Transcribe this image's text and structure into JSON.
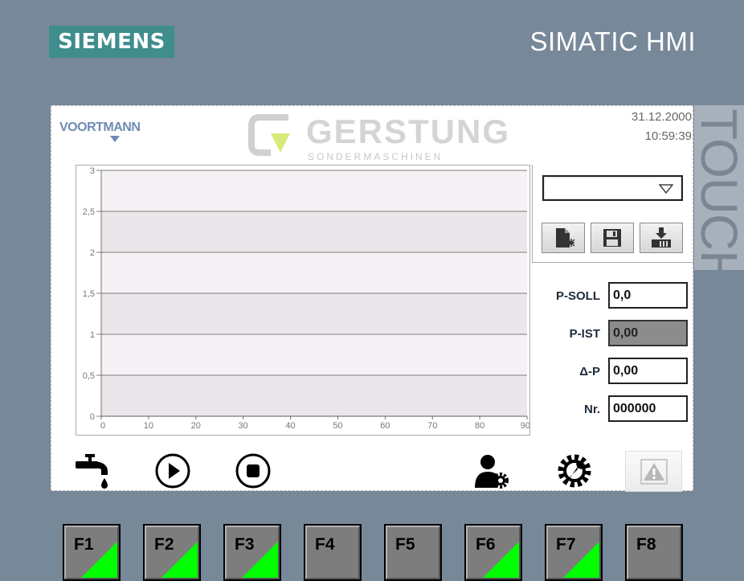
{
  "bezel": {
    "brand": "SIEMENS",
    "product": "SIMATIC HMI",
    "touch_label": "TOUCH",
    "brand_color": "#3f8d8d"
  },
  "header": {
    "logo_left": "VOORTMANN",
    "logo_center_name": "GERSTUNG",
    "logo_center_sub": "SONDERMASCHINEN",
    "date": "31.12.2000",
    "time": "10:59:39"
  },
  "chart_data": {
    "type": "line",
    "title": "",
    "xlabel": "",
    "ylabel": "",
    "xlim": [
      0,
      90
    ],
    "ylim": [
      0,
      3
    ],
    "x_ticks": [
      "0",
      "10",
      "20",
      "30",
      "40",
      "50",
      "60",
      "70",
      "80",
      "90"
    ],
    "y_ticks": [
      "0",
      "0,5",
      "1",
      "1,5",
      "2",
      "2,5",
      "3"
    ],
    "series": [],
    "grid": true
  },
  "recipe_select": {
    "value": ""
  },
  "tools": [
    {
      "name": "new-recipe",
      "icon": "new-document-icon"
    },
    {
      "name": "save-recipe",
      "icon": "floppy-disk-icon"
    },
    {
      "name": "load-recipe",
      "icon": "download-to-plc-icon"
    }
  ],
  "fields": {
    "p_soll": {
      "label": "P-SOLL",
      "value": "0,0"
    },
    "p_ist": {
      "label": "P-IST",
      "value": "0,00"
    },
    "delta_p": {
      "label": "Δ-P",
      "value": "0,00"
    },
    "nr": {
      "label": "Nr.",
      "value": "000000"
    }
  },
  "bottom_bar": [
    {
      "name": "water-tap",
      "icon": "water-tap-icon"
    },
    {
      "name": "start",
      "icon": "play-circle-icon"
    },
    {
      "name": "stop",
      "icon": "stop-circle-icon"
    },
    {
      "name": "user-settings",
      "icon": "user-gear-icon"
    },
    {
      "name": "service",
      "icon": "wrench-gear-icon"
    },
    {
      "name": "alarm",
      "icon": "warning-icon"
    }
  ],
  "function_keys": [
    {
      "label": "F1",
      "active": true
    },
    {
      "label": "F2",
      "active": true
    },
    {
      "label": "F3",
      "active": true
    },
    {
      "label": "F4",
      "active": false
    },
    {
      "label": "F5",
      "active": false
    },
    {
      "label": "F6",
      "active": true
    },
    {
      "label": "F7",
      "active": true
    },
    {
      "label": "F8",
      "active": false
    }
  ],
  "colors": {
    "fkey_indicator": "#00ff00",
    "bezel": "#778899"
  }
}
